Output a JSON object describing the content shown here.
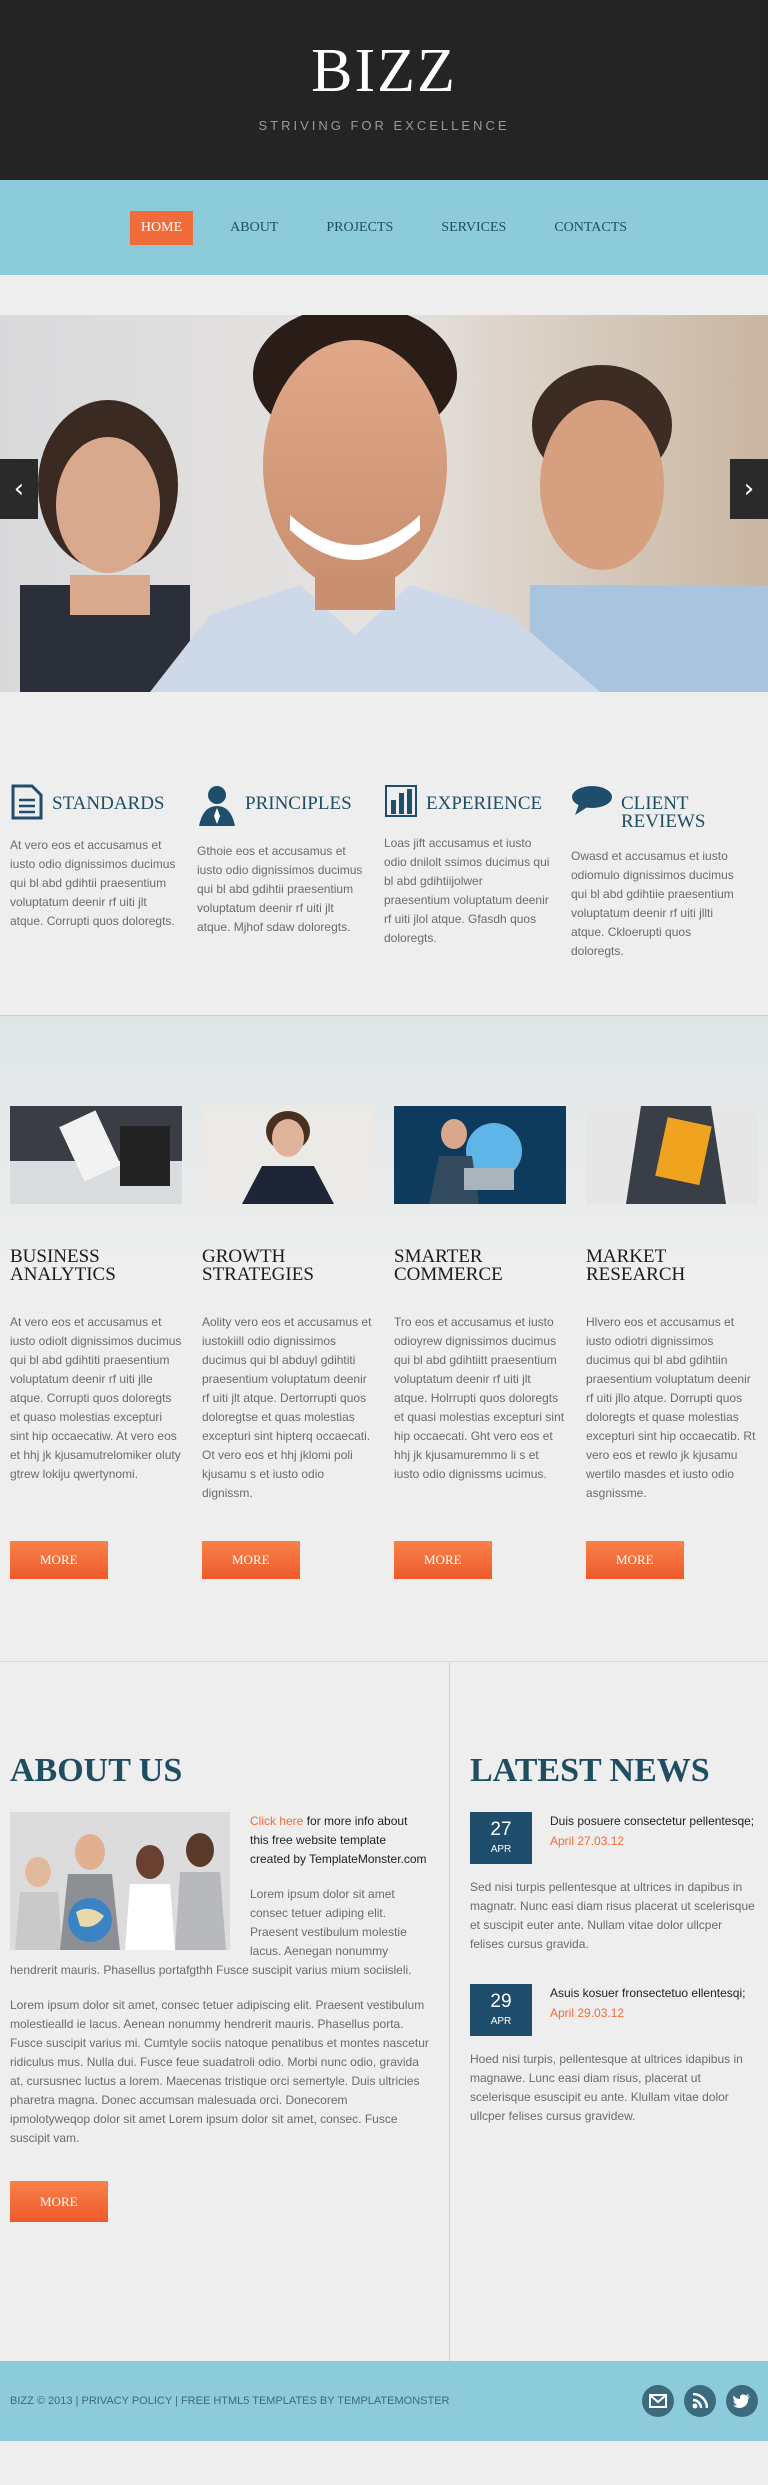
{
  "header": {
    "logo": "BIZZ",
    "slogan": "STRIVING FOR EXCELLENCE"
  },
  "nav": {
    "items": [
      "HOME",
      "ABOUT",
      "PROJECTS",
      "SERVICES",
      "CONTACTS"
    ],
    "active": "HOME"
  },
  "slider": {
    "prev": "‹",
    "next": "›"
  },
  "features": [
    {
      "title": "STANDARDS",
      "icon": "document-icon",
      "text": "At vero eos et accusamus et iusto odio dignissimos ducimus qui bl abd gdihtii praesentium voluptatum deenir rf uiti jlt atque. Corrupti quos doloregts."
    },
    {
      "title": "PRINCIPLES",
      "icon": "person-icon",
      "text": "Gthoie eos et accusamus et iusto odio dignissimos ducimus qui bl abd gdihtii praesentium voluptatum deenir rf uiti jlt atque. Mjhof sdaw doloregts."
    },
    {
      "title": "EXPERIENCE",
      "icon": "bar-chart-icon",
      "text": "Loas jift accusamus et iusto odio dnilolt ssimos ducimus qui bl abd gdihtiijolwer praesentium voluptatum deenir rf uiti jlol atque. Gfasdh quos doloregts."
    },
    {
      "title": "CLIENT REVIEWS",
      "icon": "speech-bubble-icon",
      "text": "Owasd et accusamus et iusto odiomulo dignissimos ducimus qui bl abd gdihtiie praesentium voluptatum deenir rf uiti jllti atque. Ckloerupti quos doloregts."
    }
  ],
  "services": [
    {
      "title": "BUSINESS ANALYTICS",
      "text": "At vero eos et accusamus et iusto odiolt dignissimos ducimus qui bl abd gdihtiti praesentium voluptatum deenir rf uiti jlle atque. Corrupti quos doloregts et quaso molestias excepturi sint hip occaecatiw. At vero eos et hhj jk kjusamutrelomiker oluty gtrew lokiju qwertynomi.",
      "button": "MORE"
    },
    {
      "title": "GROWTH STRATEGIES",
      "text": "Aolity vero eos et accusamus et iustokiill odio dignissimos ducimus qui bl abduyl gdihtiti praesentium voluptatum deenir rf uiti jlt atque. Dertorrupti quos doloregtse et quas molestias excepturi sint hipterq occaecati. Ot vero eos et hhj jklomi poli kjusamu s et iusto odio dignissm.",
      "button": "MORE"
    },
    {
      "title": "SMARTER COMMERCE",
      "text": "Tro eos et accusamus et iusto odioyrew dignissimos ducimus qui bl abd gdihtiitt praesentium voluptatum deenir rf uiti jlt atque. Holrrupti quos doloregts et quasi molestias excepturi sint hip occaecati. Ght vero eos et hhj jk kjusamuremmo li s et iusto odio dignissms ucimus.",
      "button": "MORE"
    },
    {
      "title": "MARKET RESEARCH",
      "text": "Hlvero eos et accusamus et iusto odiotri dignissimos ducimus qui bl abd gdihtiin praesentium voluptatum deenir rf uiti jllo atque. Dorrupti quos doloregts et quase molestias excepturi sint hip occaecatib. Rt vero eos et rewlo jk kjusamu wertilo masdes et iusto odio asgnissme.",
      "button": "MORE"
    }
  ],
  "about": {
    "title": "ABOUT US",
    "link_text": "Click here",
    "intro": " for more info about this free website template created by TemplateMonster.com",
    "para1": "Lorem ipsum dolor sit amet consec tetuer adiping elit. Praesent vestibulum molestie lacus. Aenegan nonummy hendrerit mauris. Phasellus portafgthh Fusce suscipit varius mium sociisleli.",
    "para2": "Lorem ipsum dolor sit amet, consec tetuer adipiscing elit. Praesent vestibulum molestiealld ie lacus. Aenean nonummy hendrerit mauris. Phasellus porta. Fusce suscipit varius mi. Cumtyle sociis natoque penatibus et montes nascetur ridiculus mus. Nulla dui. Fusce feue suadatroli odio. Morbi nunc odio, gravida at, cursusnec luctus a lorem. Maecenas tristique orci semertyle. Duis ultricies pharetra magna. Donec accumsan malesuada orci. Donecorem ipmolotyweqop dolor sit amet Lorem ipsum dolor sit amet, consec. Fusce suscipit vam.",
    "button": "MORE"
  },
  "news": {
    "title": "LATEST NEWS",
    "items": [
      {
        "day": "27",
        "month": "APR",
        "headline": "Duis posuere consectetur pellentesqe;",
        "date": "April 27.03.12",
        "text": "Sed nisi turpis pellentesque at ultrices in dapibus in magnatr. Nunc easi diam risus placerat ut scelerisque et suscipit euter ante. Nullam vitae dolor ullcper felises cursus gravida."
      },
      {
        "day": "29",
        "month": "APR",
        "headline": "Asuis kosuer fronsectetuo ellentesqi;",
        "date": "April 29.03.12",
        "text": "Hoed nisi turpis, pellentesque at ultrices idapibus in magnawe. Lunc easi diam risus, placerat ut scelerisque esuscipit eu ante. Klullam vitae dolor ullcper felises cursus gravidew."
      }
    ]
  },
  "footer": {
    "text": "BIZZ © 2013 | PRIVACY POLICY | FREE HTML5 TEMPLATES BY TEMPLATEMONSTER",
    "socials": [
      "mail-icon",
      "rss-icon",
      "twitter-icon"
    ]
  },
  "colors": {
    "accent": "#f26b3a",
    "nav_bg": "#8ccbd9",
    "header_bg": "#242424",
    "heading": "#1f4e63"
  }
}
